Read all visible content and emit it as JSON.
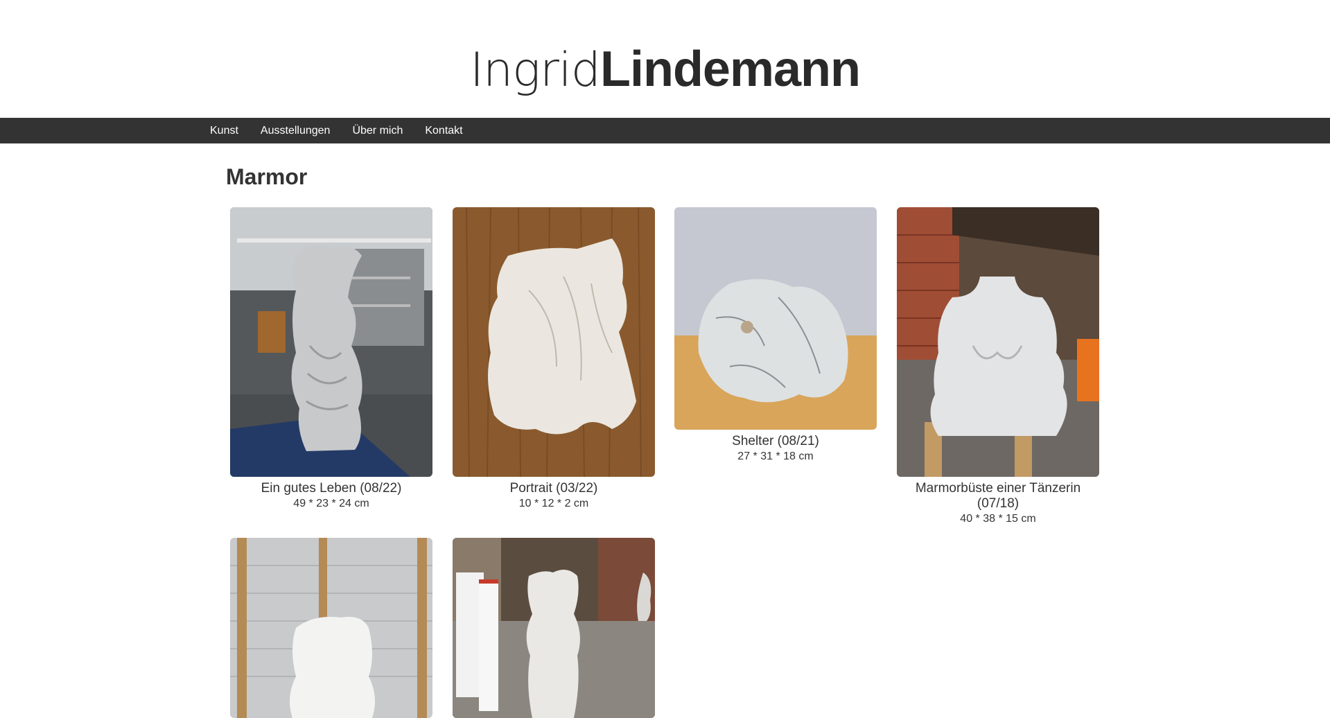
{
  "site": {
    "logo_light": "Ingrid",
    "logo_bold": "Lindemann"
  },
  "nav": {
    "items": [
      "Kunst",
      "Ausstellungen",
      "Über mich",
      "Kontakt"
    ]
  },
  "page": {
    "title": "Marmor"
  },
  "gallery": [
    {
      "title": "Ein gutes Leben (08/22)",
      "dimensions": "49 * 23 * 24 cm"
    },
    {
      "title": "Portrait (03/22)",
      "dimensions": "10 * 12 * 2 cm"
    },
    {
      "title": "Shelter (08/21)",
      "dimensions": "27 * 31 * 18 cm"
    },
    {
      "title": "Marmorbüste einer Tänzerin (07/18)",
      "dimensions": "40 * 38 * 15 cm"
    }
  ],
  "colors": {
    "nav_background": "#333333",
    "text": "#333333"
  }
}
